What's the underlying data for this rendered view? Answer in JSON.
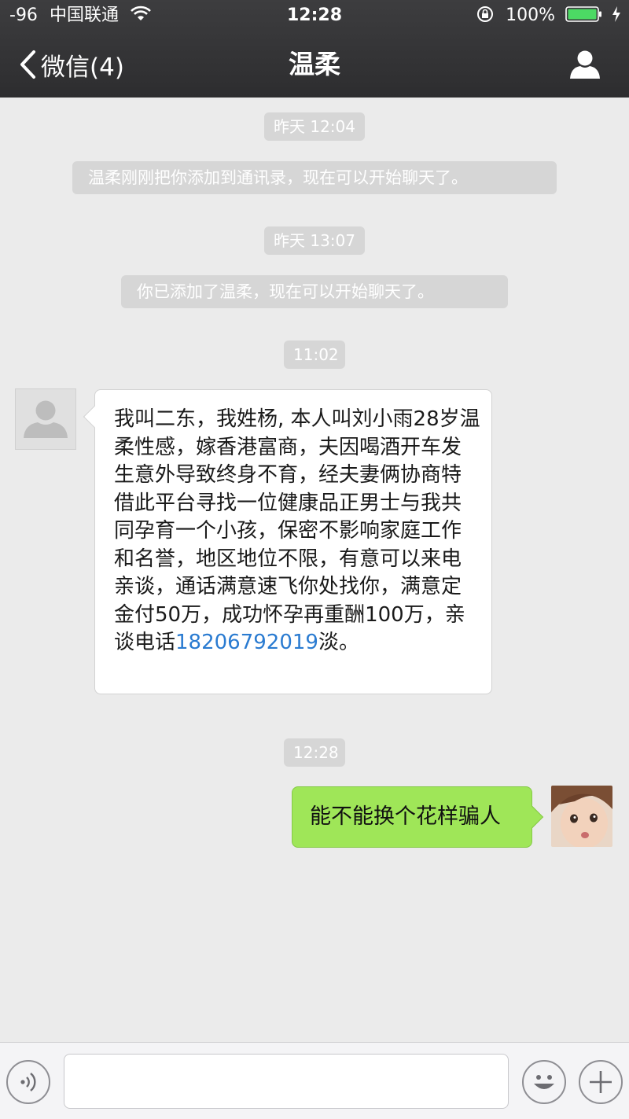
{
  "status_bar": {
    "signal": "-96",
    "carrier": "中国联通",
    "time": "12:28",
    "battery": "100%"
  },
  "nav": {
    "back_label": "微信(4)",
    "title": "温柔"
  },
  "messages": [
    {
      "type": "time",
      "text": "昨天 12:04"
    },
    {
      "type": "system",
      "text": "温柔刚刚把你添加到通讯录，现在可以开始聊天了。"
    },
    {
      "type": "time",
      "text": "昨天 13:07"
    },
    {
      "type": "system",
      "text": "你已添加了温柔，现在可以开始聊天了。"
    },
    {
      "type": "time",
      "text": "11:02"
    },
    {
      "type": "incoming",
      "text": "我叫二东，我姓杨, 本人叫刘小雨28岁温柔性感，嫁香港富商，夫因喝酒开车发生意外导致终身不育，经夫妻俩协商特借此平台寻找一位健康品正男士与我共同孕育一个小孩，保密不影响家庭工作和名誉，地区地位不限，有意可以来电亲谈，通话满意速飞你处找你，满意定金付50万，成功怀孕再重酬100万，亲谈电话",
      "link": "18206792019",
      "suffix": "淡。"
    },
    {
      "type": "time",
      "text": "12:28"
    },
    {
      "type": "outgoing",
      "text": "能不能换个花样骗人"
    }
  ],
  "input": {
    "value": ""
  },
  "colors": {
    "nav_bg": "#2d2d2f",
    "outgoing_bubble": "#9fe658",
    "link": "#2a7bd1",
    "chat_bg": "#ebebeb"
  },
  "icons": [
    "back-chevron-icon",
    "wifi-icon",
    "rotation-lock-icon",
    "battery-icon",
    "charging-icon",
    "profile-icon",
    "voice-icon",
    "emoji-icon",
    "plus-icon"
  ]
}
